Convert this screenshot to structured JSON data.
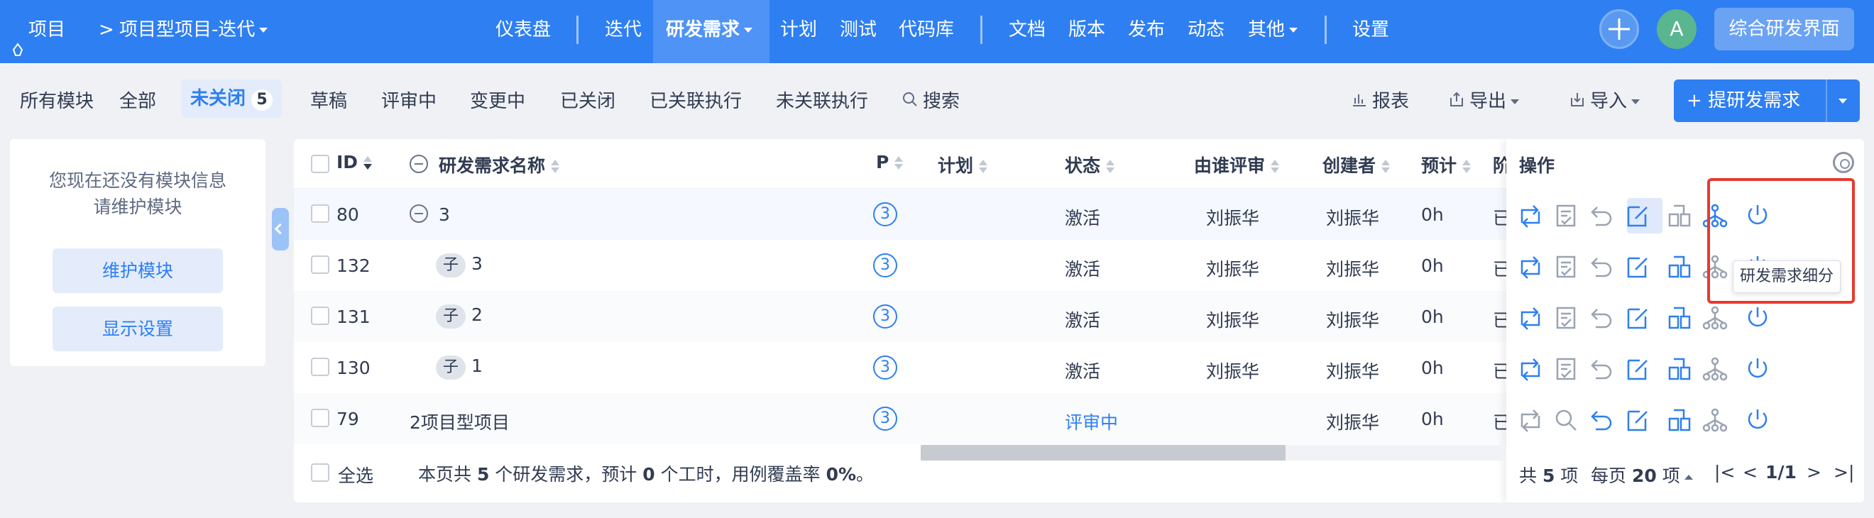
{
  "topbar": {
    "project_label": "项目",
    "breadcrumb": "项目型项目-迭代",
    "nav": [
      "仪表盘",
      "迭代",
      "研发需求",
      "计划",
      "测试",
      "代码库",
      "文档",
      "版本",
      "发布",
      "动态",
      "其他",
      "设置"
    ],
    "avatar_letter": "A",
    "switch_label": "综合研发界面"
  },
  "featurebar": {
    "all_modules": "所有模块",
    "tabs": [
      "全部",
      "未关闭",
      "草稿",
      "评审中",
      "变更中",
      "已关闭",
      "已关联执行",
      "未关联执行"
    ],
    "unclosed_count": "5",
    "search": "搜索",
    "report": "报表",
    "export": "导出",
    "import": "导入",
    "create": "提研发需求"
  },
  "sidebar": {
    "empty_line1": "您现在还没有模块信息",
    "empty_line2": "请维护模块",
    "maintain": "维护模块",
    "display_settings": "显示设置"
  },
  "table": {
    "headers": [
      "ID",
      "研发需求名称",
      "P",
      "计划",
      "状态",
      "由谁评审",
      "创建者",
      "预计",
      "阶"
    ],
    "actions_header": "操作",
    "rows": [
      {
        "id": "80",
        "name": "3",
        "child": "",
        "pri": "3",
        "status": "激活",
        "reviewer": "刘振华",
        "creator": "刘振华",
        "estimate": "0h",
        "stage": "已"
      },
      {
        "id": "132",
        "name": "3",
        "child": "子",
        "pri": "3",
        "status": "激活",
        "reviewer": "刘振华",
        "creator": "刘振华",
        "estimate": "0h",
        "stage": "已"
      },
      {
        "id": "131",
        "name": "2",
        "child": "子",
        "pri": "3",
        "status": "激活",
        "reviewer": "刘振华",
        "creator": "刘振华",
        "estimate": "0h",
        "stage": "已"
      },
      {
        "id": "130",
        "name": "1",
        "child": "子",
        "pri": "3",
        "status": "激活",
        "reviewer": "刘振华",
        "creator": "刘振华",
        "estimate": "0h",
        "stage": "已"
      },
      {
        "id": "79",
        "name": "2项目型项目",
        "child": "",
        "pri": "3",
        "status": "评审中",
        "reviewer": "",
        "creator": "刘振华",
        "estimate": "0h",
        "stage": "已"
      }
    ],
    "tooltip": "研发需求细分"
  },
  "footer": {
    "select_all": "全选",
    "summary_pre": "本页共 ",
    "summary_count": "5",
    "summary_mid": " 个研发需求，预计 ",
    "summary_hours": "0",
    "summary_mid2": " 个工时，用例覆盖率 ",
    "summary_rate": "0%",
    "summary_end": "。",
    "total_pre": "共 ",
    "total": "5",
    "total_post": " 项",
    "per_page_pre": "每页 ",
    "per_page": "20",
    "per_page_post": " 项",
    "page": "1/1"
  },
  "colors": {
    "accent": "#2e7ff2",
    "highlight": "#e8392f"
  }
}
